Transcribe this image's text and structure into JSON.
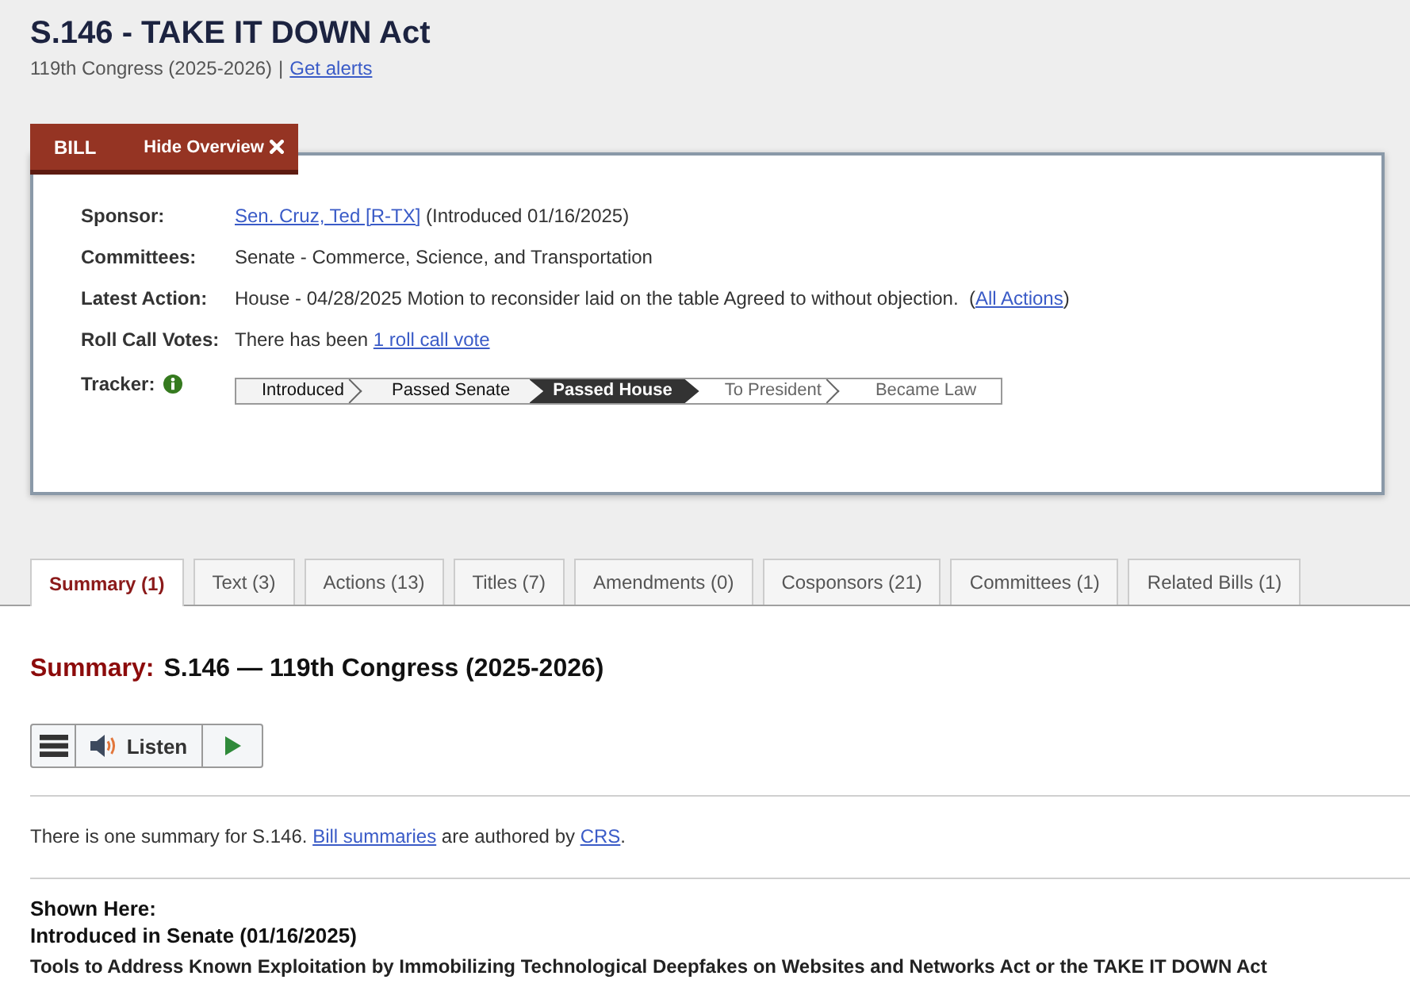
{
  "bill": {
    "title": "S.146 - TAKE IT DOWN Act",
    "congress": "119th Congress (2025-2026)",
    "separator": "|",
    "alerts_link": "Get alerts"
  },
  "overview": {
    "tab_label": "BILL",
    "hide_button": "Hide Overview",
    "rows": [
      {
        "kind": "parts",
        "label": "Sponsor:",
        "parts": [
          {
            "kind": "link",
            "text": "Sen. Cruz, Ted [R-TX]"
          },
          {
            "kind": "text",
            "text": " (Introduced 01/16/2025)"
          }
        ]
      },
      {
        "kind": "parts",
        "label": "Committees:",
        "parts": [
          {
            "kind": "text",
            "text": "Senate - Commerce, Science, and Transportation"
          }
        ]
      },
      {
        "kind": "parts",
        "label": "Latest Action:",
        "parts": [
          {
            "kind": "text",
            "text": "House - 04/28/2025 Motion to reconsider laid on the table Agreed to without objection.  ("
          },
          {
            "kind": "link",
            "text": "All Actions"
          },
          {
            "kind": "text",
            "text": ")"
          }
        ]
      },
      {
        "kind": "parts",
        "label": "Roll Call Votes:",
        "parts": [
          {
            "kind": "text",
            "text": "There has been "
          },
          {
            "kind": "link",
            "text": "1 roll call vote"
          }
        ]
      },
      {
        "kind": "tracker",
        "label": "Tracker:",
        "steps": [
          {
            "label": "Introduced",
            "passed": true,
            "current": false
          },
          {
            "label": "Passed Senate",
            "passed": true,
            "current": false
          },
          {
            "label": "Passed House",
            "passed": true,
            "current": true
          },
          {
            "label": "To President",
            "passed": false,
            "current": false
          },
          {
            "label": "Became Law",
            "passed": false,
            "current": false
          }
        ]
      }
    ]
  },
  "tabs": [
    {
      "label": "Summary (1)",
      "selected": true
    },
    {
      "label": "Text (3)",
      "selected": false
    },
    {
      "label": "Actions (13)",
      "selected": false
    },
    {
      "label": "Titles (7)",
      "selected": false
    },
    {
      "label": "Amendments (0)",
      "selected": false
    },
    {
      "label": "Cosponsors (21)",
      "selected": false
    },
    {
      "label": "Committees (1)",
      "selected": false
    },
    {
      "label": "Related Bills (1)",
      "selected": false
    }
  ],
  "summary": {
    "heading_label": "Summary:",
    "heading_title": "S.146 — 119th Congress (2025-2026)",
    "player": {
      "listen_button": "Listen"
    },
    "note": [
      {
        "kind": "text",
        "text": "There is one summary for S.146. "
      },
      {
        "kind": "link",
        "text": "Bill summaries"
      },
      {
        "kind": "text",
        "text": " are authored by "
      },
      {
        "kind": "link",
        "text": "CRS"
      },
      {
        "kind": "text",
        "text": "."
      }
    ],
    "shown_here": {
      "label": "Shown Here:",
      "version": "Introduced in Senate (01/16/2025)",
      "title": "Tools to Address Known Exploitation by Immobilizing Technological Deepfakes on Websites and Networks Act or the TAKE IT DOWN Act"
    }
  }
}
